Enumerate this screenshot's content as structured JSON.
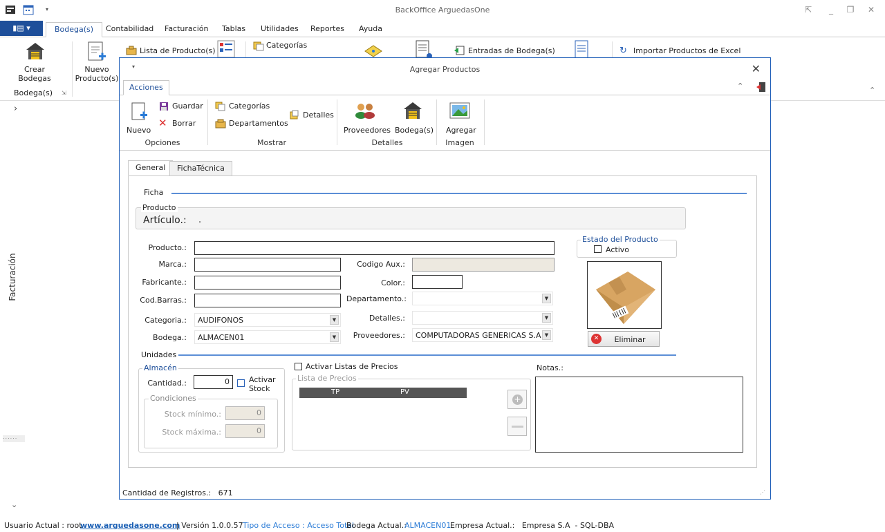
{
  "app": {
    "title": "BackOffice ArguedasOne"
  },
  "menu": {
    "tabs": [
      {
        "label": "Bodega(s)"
      },
      {
        "label": "Contabilidad"
      },
      {
        "label": "Facturación"
      },
      {
        "label": "Tablas"
      },
      {
        "label": "Utilidades"
      },
      {
        "label": "Reportes"
      },
      {
        "label": "Ayuda"
      }
    ]
  },
  "ribbon": {
    "crear_bodegas": "Crear\nBodegas",
    "nuevo_producto": "Nuevo\nProducto(s)",
    "lista_productos": "Lista de Producto(s)",
    "categorias": "Categorías",
    "entradas_bodega": "Entradas de Bodega(s)",
    "importar_excel": "Importar Productos de Excel",
    "group_bodegas": "Bodega(s)"
  },
  "leftnav": {
    "label": "Facturación"
  },
  "dialog": {
    "title": "Agregar Productos",
    "tab": "Acciones",
    "toolbar": {
      "nuevo": "Nuevo",
      "guardar": "Guardar",
      "borrar": "Borrar",
      "opciones": "Opciones",
      "categorias": "Categorías",
      "departamentos": "Departamentos",
      "detalles": "Detalles",
      "mostrar": "Mostrar",
      "proveedores": "Proveedores",
      "bodegas": "Bodega(s)",
      "detalles_group": "Detalles",
      "agregar": "Agregar",
      "imagen": "Imagen"
    },
    "subtabs": [
      {
        "label": "General"
      },
      {
        "label": "FichaTécnica"
      }
    ],
    "ficha_label": "Ficha",
    "producto_group": "Producto",
    "articulo_label": "Artículo.:",
    "articulo_value": ".",
    "fields": {
      "producto": {
        "label": "Producto.:",
        "value": ""
      },
      "marca": {
        "label": "Marca.:",
        "value": ""
      },
      "fabricante": {
        "label": "Fabricante.:",
        "value": ""
      },
      "cod_barras": {
        "label": "Cod.Barras.:",
        "value": ""
      },
      "categoria": {
        "label": "Categoria.:",
        "value": "AUDIFONOS"
      },
      "bodega": {
        "label": "Bodega.:",
        "value": "ALMACEN01"
      },
      "codigo_aux": {
        "label": "Codigo Aux.:",
        "value": ""
      },
      "color": {
        "label": "Color.:",
        "value": ""
      },
      "departamento": {
        "label": "Departamento.:",
        "value": ""
      },
      "detalles": {
        "label": "Detalles.:",
        "value": ""
      },
      "proveedores": {
        "label": "Proveedores.:",
        "value": "COMPUTADORAS GENERICAS S.A"
      }
    },
    "estado": {
      "title": "Estado del Producto",
      "activo": "Activo"
    },
    "eliminar": "Eliminar",
    "unidades_label": "Unidades",
    "almacen": {
      "title": "Almacén",
      "cantidad_label": "Cantidad.:",
      "cantidad_value": "0",
      "activar_stock": "Activar\nStock",
      "condiciones": "Condiciones",
      "stock_min_label": "Stock mínimo.:",
      "stock_min_value": "0",
      "stock_max_label": "Stock máxima.:",
      "stock_max_value": "0"
    },
    "precios": {
      "activar": "Activar Listas de Precios",
      "lista": "Lista de Precios",
      "col_tp": "TP",
      "col_pv": "PV"
    },
    "notas_label": "Notas.:",
    "registros": "Cantidad de Registros.:   671"
  },
  "status": {
    "usuario": "Usuario Actual : root",
    "link": "www.arguedasone.com",
    "version": "| Versión 1.0.0.57",
    "acceso": "Tipo de Acceso : Acceso Total",
    "bodega_label": "Bodega Actual.:",
    "bodega_value": "ALMACEN01",
    "empresa": "Empresa Actual.:   Empresa S.A  - SQL-DBA"
  },
  "colors": {
    "accent": "#1e4f9a",
    "link": "#2a7bd6",
    "dialog_border": "#1e5eb8"
  }
}
